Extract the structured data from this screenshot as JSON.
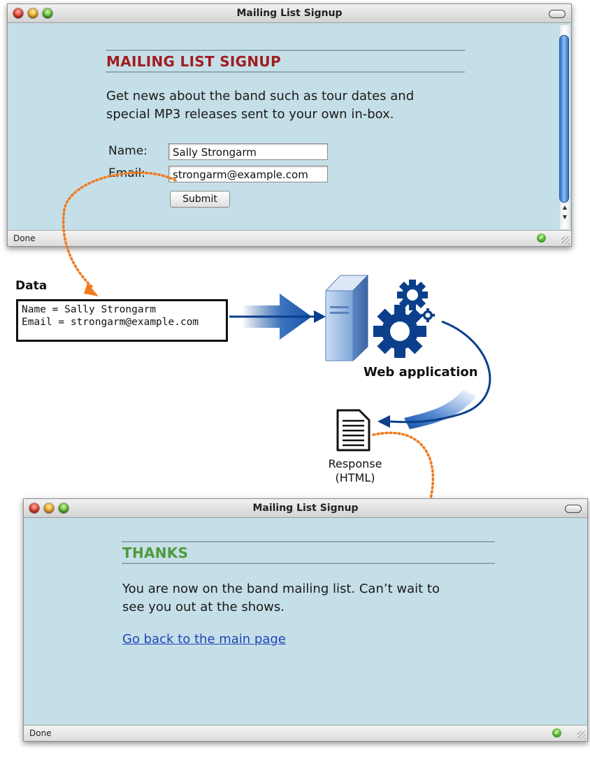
{
  "window1": {
    "title": "Mailing List Signup",
    "heading": "MAILING LIST SIGNUP",
    "heading_color": "#a11d21",
    "para_line1": "Get news about the band such as tour dates and",
    "para_line2": "special MP3 releases sent to your own in-box.",
    "name_label": "Name:",
    "name_value": "Sally Strongarm",
    "email_label": "Email:",
    "email_value": "strongarm@example.com",
    "submit_label": "Submit",
    "status": "Done"
  },
  "diagram": {
    "data_title": "Data",
    "data_line1": "Name = Sally Strongarm",
    "data_line2": "Email = strongarm@example.com",
    "webapp_label": "Web application",
    "response_line1": "Response",
    "response_line2": "(HTML)",
    "arrow_color": "#0b3f8c",
    "dotted_color": "#f07a1e"
  },
  "window2": {
    "title": "Mailing List Signup",
    "heading": "THANKS",
    "heading_color": "#4f9a3c",
    "para_line1": "You are now on the band mailing list. Can’t wait to",
    "para_line2": "see you out at the shows.",
    "link_text": "Go back to the main page",
    "status": "Done"
  }
}
